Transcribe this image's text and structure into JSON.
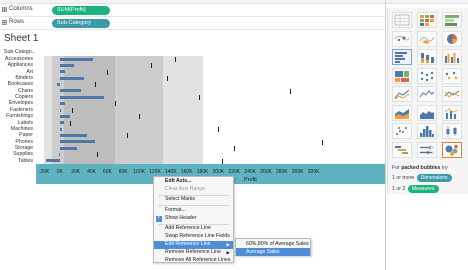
{
  "shelves": {
    "columns_label": "Columns",
    "columns_pill": "SUM(Profit)",
    "columns_color": "#1db37e",
    "rows_label": "Rows",
    "rows_pill": "Sub-Category",
    "rows_color": "#3d9aa8"
  },
  "sheet_title": "Sheet 1",
  "axis_header": "Sub-Catego..",
  "chart_data": {
    "type": "bar",
    "categories": [
      "Accessories",
      "Appliances",
      "Art",
      "Binders",
      "Bookcases",
      "Chairs",
      "Copiers",
      "Envelopes",
      "Fasteners",
      "Furnishings",
      "Labels",
      "Machines",
      "Paper",
      "Phones",
      "Storage",
      "Supplies",
      "Tables"
    ],
    "values": [
      41937,
      18138,
      6528,
      30222,
      -3473,
      26590,
      55618,
      6964,
      950,
      13059,
      5546,
      3385,
      34054,
      44516,
      21279,
      -1189,
      -17725
    ],
    "ref_lines": [
      145000,
      115000,
      60000,
      135000,
      45000,
      290000,
      175000,
      70000,
      15000,
      100000,
      13000,
      200000,
      85000,
      330000,
      220000,
      47000,
      205000
    ],
    "xlabel": "Profit",
    "xlim": [
      -30000,
      410000
    ],
    "xticks": [
      "-20K",
      "0K",
      "20K",
      "40K",
      "60K",
      "80K",
      "100K",
      "120K",
      "140K",
      "160K",
      "180K",
      "200K",
      "220K",
      "240K",
      "260K",
      "280K",
      "300K",
      "320K"
    ],
    "xtick_values": [
      -20000,
      0,
      20000,
      40000,
      60000,
      80000,
      100000,
      120000,
      140000,
      160000,
      180000,
      200000,
      220000,
      240000,
      260000,
      280000,
      300000,
      320000
    ],
    "band_colors": [
      "#e2e2e2",
      "#cdcdcd",
      "#bdbdbd"
    ],
    "bar_color": "#4e79a7"
  },
  "axis_bar_color": "#5fb3c0",
  "context_menu": {
    "items": [
      {
        "label": "Edit Axis...",
        "style": "bold"
      },
      {
        "label": "Clear Axis Range",
        "style": "disabled"
      },
      {
        "label": "Select Marks",
        "style": "normal"
      },
      {
        "label": "Format...",
        "style": "normal"
      },
      {
        "label": "Show Header",
        "style": "checked"
      },
      {
        "label": "Add Reference Line",
        "style": "normal"
      },
      {
        "label": "Swap Reference Line Fields",
        "style": "normal"
      },
      {
        "label": "Edit Reference Line",
        "style": "submenu-highlight"
      },
      {
        "label": "Remove Reference Line",
        "style": "submenu"
      },
      {
        "label": "Remove All Reference Lines",
        "style": "normal"
      }
    ],
    "submenu": [
      "60%,80% of Average Sales",
      "Average Sales"
    ],
    "highlight_color": "#4f8ed6"
  },
  "show_me": {
    "hint_prefix": "For",
    "hint_bold": "packed bubbles",
    "hint_suffix": "try",
    "line2_prefix": "1 or more",
    "dimensions_badge": "Dimensions",
    "dimensions_color": "#3d9aa8",
    "line3_prefix": "1 or 2",
    "measures_badge": "Measures",
    "measures_color": "#1db37e",
    "tiles": [
      "text-table-icon",
      "heat-map-icon",
      "highlight-table-icon",
      "symbol-map-icon",
      "filled-map-icon",
      "pie-chart-icon",
      "horizontal-bars-icon",
      "stacked-bars-icon",
      "side-by-side-bars-icon",
      "treemap-icon",
      "circle-views-icon",
      "side-by-side-circles-icon",
      "lines-continuous-icon",
      "lines-discrete-icon",
      "dual-lines-icon",
      "area-continuous-icon",
      "area-discrete-icon",
      "dual-combination-icon",
      "scatter-plot-icon",
      "histogram-icon",
      "box-whisker-icon",
      "gantt-chart-icon",
      "bullet-graph-icon",
      "packed-bubbles-icon"
    ]
  }
}
